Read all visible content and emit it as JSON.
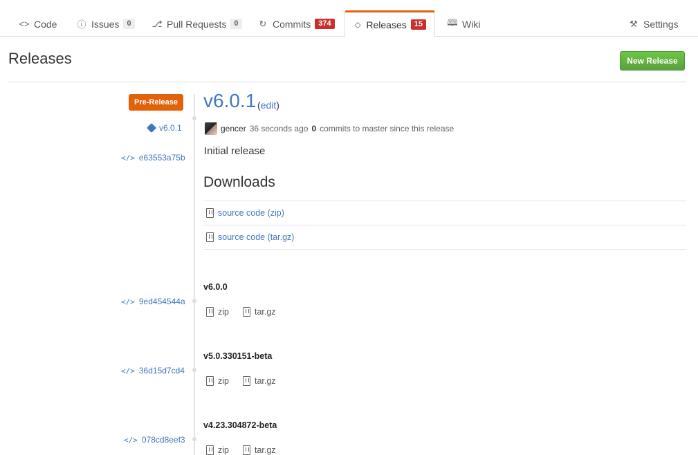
{
  "tabs": [
    {
      "label": "Code",
      "icon": "code-icon"
    },
    {
      "label": "Issues",
      "icon": "issue-icon",
      "count": "0"
    },
    {
      "label": "Pull Requests",
      "icon": "pull-request-icon",
      "count": "0"
    },
    {
      "label": "Commits",
      "icon": "history-icon",
      "count": "374"
    },
    {
      "label": "Releases",
      "icon": "tag-icon",
      "count": "15"
    },
    {
      "label": "Wiki",
      "icon": "book-icon"
    },
    {
      "label": "Settings",
      "icon": "tools-icon"
    }
  ],
  "header": {
    "title": "Releases",
    "new_release_label": "New Release"
  },
  "latest": {
    "badge": "Pre-Release",
    "tag": "v6.0.1",
    "commit": "e63553a75b",
    "title": "v6.0.1",
    "edit_open": "(",
    "edit_label": "edit",
    "edit_close": ")",
    "author": "gencer",
    "time": "36 seconds ago",
    "commits_count": "0",
    "commits_suffix": "commits to master since this release",
    "body": "Initial release",
    "downloads_title": "Downloads",
    "downloads": [
      "source code (zip)",
      "source code (tar.gz)"
    ]
  },
  "releases": [
    {
      "title": "v6.0.0",
      "commit": "9ed454544a",
      "zip": "zip",
      "targz": "tar.gz"
    },
    {
      "title": "v5.0.330151-beta",
      "commit": "36d15d7cd4",
      "zip": "zip",
      "targz": "tar.gz"
    },
    {
      "title": "v4.23.304872-beta",
      "commit": "078cd8eef3",
      "zip": "zip",
      "targz": "tar.gz"
    }
  ],
  "colors": {
    "accent": "#e36209",
    "link": "#4078c0",
    "counter_red": "#c9302c",
    "button_green": "#6cc644"
  }
}
